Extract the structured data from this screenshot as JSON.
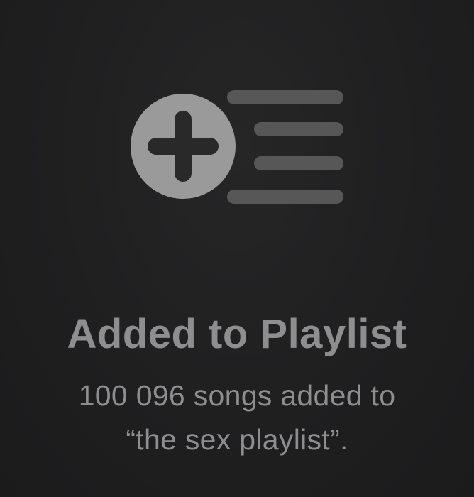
{
  "hud": {
    "icon": "add-to-playlist-icon",
    "title": "Added to Playlist",
    "message_line1": "100 096 songs added to",
    "message_line2": "“the sex playlist”."
  },
  "colors": {
    "background": "#1e1e1f",
    "icon_circle": "#9a9a9b",
    "icon_lines": "#575758",
    "text": "#8e8e90"
  }
}
